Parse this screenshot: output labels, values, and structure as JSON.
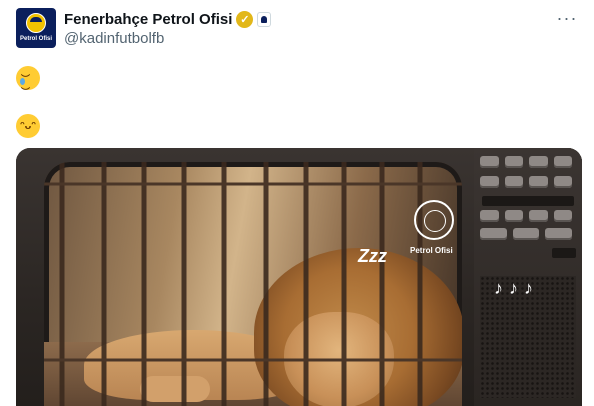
{
  "tweet": {
    "display_name": "Fenerbahçe Petrol Ofisi",
    "handle": "@kadinfutbolfb",
    "more_label": "···",
    "verified_mark": "✓",
    "avatar_text": "Petrol Ofisi",
    "emoji_1": "crying-face",
    "emoji_2": "grinning-face",
    "media": {
      "alt": "sleeping lion in cage on vintage TV",
      "zzz": "Zzz",
      "logo_text": "Petrol Ofisi",
      "music_notes": "♪♪♪"
    }
  },
  "colors": {
    "verified_badge": "#e2b719",
    "brand_navy": "#0b1f5c",
    "text_primary": "#0f1419",
    "text_secondary": "#536471"
  }
}
